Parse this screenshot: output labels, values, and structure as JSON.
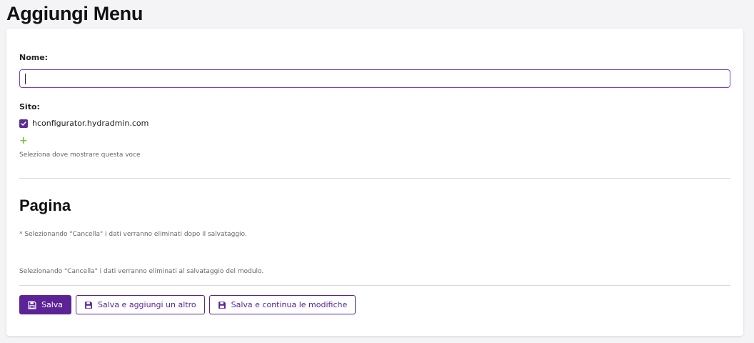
{
  "page": {
    "title": "Aggiungi Menu"
  },
  "form": {
    "name_label": "Nome:",
    "name_value": "",
    "site_label": "Sito:",
    "site_option": "hconfigurator.hydradmin.com",
    "site_checked": true,
    "add_icon": "+",
    "site_help": "Seleziona dove mostrare questa voce"
  },
  "pagina": {
    "title": "Pagina",
    "note": "* Selezionando \"Cancella\" i dati verranno eliminati dopo il salvataggio.",
    "help": "Selezionando \"Cancella\" i dati verranno eliminati al salvataggio del modulo."
  },
  "actions": {
    "save_label": "Salva",
    "save_add_label": "Salva e aggiungi un altro",
    "save_continue_label": "Salva e continua le modifiche"
  },
  "icons": {
    "button_icon": "floppy-disk-icon",
    "checkbox_icon": "check-icon",
    "add_icon": "plus-icon"
  },
  "colors": {
    "accent": "#5c2396",
    "add_green": "#7cc04a",
    "background": "#f4f4f6"
  }
}
